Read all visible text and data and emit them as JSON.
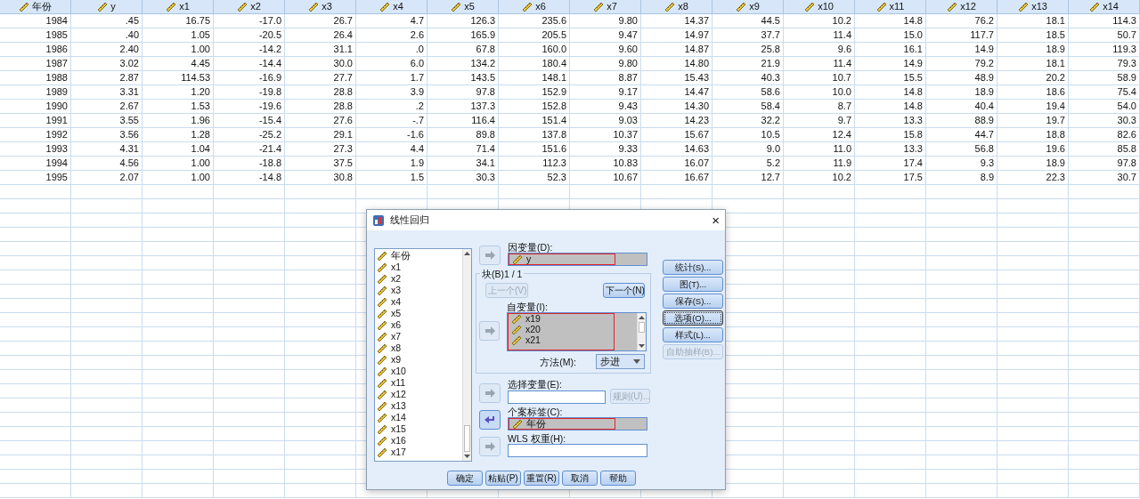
{
  "data_view": {
    "columns": [
      "年份",
      "y",
      "x1",
      "x2",
      "x3",
      "x4",
      "x5",
      "x6",
      "x7",
      "x8",
      "x9",
      "x10",
      "x11",
      "x12",
      "x13",
      "x14"
    ],
    "rows": [
      [
        "1984",
        ".45",
        "16.75",
        "-17.0",
        "26.7",
        "4.7",
        "126.3",
        "235.6",
        "9.80",
        "14.37",
        "44.5",
        "10.2",
        "14.8",
        "76.2",
        "18.1",
        "114.3"
      ],
      [
        "1985",
        ".40",
        "1.05",
        "-20.5",
        "26.4",
        "2.6",
        "165.9",
        "205.5",
        "9.47",
        "14.97",
        "37.7",
        "11.4",
        "15.0",
        "117.7",
        "18.5",
        "50.7"
      ],
      [
        "1986",
        "2.40",
        "1.00",
        "-14.2",
        "31.1",
        ".0",
        "67.8",
        "160.0",
        "9.60",
        "14.87",
        "25.8",
        "9.6",
        "16.1",
        "14.9",
        "18.9",
        "119.3"
      ],
      [
        "1987",
        "3.02",
        "4.45",
        "-14.4",
        "30.0",
        "6.0",
        "134.2",
        "180.4",
        "9.80",
        "14.80",
        "21.9",
        "11.4",
        "14.9",
        "79.2",
        "18.1",
        "79.3"
      ],
      [
        "1988",
        "2.87",
        "114.53",
        "-16.9",
        "27.7",
        "1.7",
        "143.5",
        "148.1",
        "8.87",
        "15.43",
        "40.3",
        "10.7",
        "15.5",
        "48.9",
        "20.2",
        "58.9"
      ],
      [
        "1989",
        "3.31",
        "1.20",
        "-19.8",
        "28.8",
        "3.9",
        "97.8",
        "152.9",
        "9.17",
        "14.47",
        "58.6",
        "10.0",
        "14.8",
        "18.9",
        "18.6",
        "75.4"
      ],
      [
        "1990",
        "2.67",
        "1.53",
        "-19.6",
        "28.8",
        ".2",
        "137.3",
        "152.8",
        "9.43",
        "14.30",
        "58.4",
        "8.7",
        "14.8",
        "40.4",
        "19.4",
        "54.0"
      ],
      [
        "1991",
        "3.55",
        "1.96",
        "-15.4",
        "27.6",
        "-.7",
        "116.4",
        "151.4",
        "9.03",
        "14.23",
        "32.2",
        "9.7",
        "13.3",
        "88.9",
        "19.7",
        "30.3"
      ],
      [
        "1992",
        "3.56",
        "1.28",
        "-25.2",
        "29.1",
        "-1.6",
        "89.8",
        "137.8",
        "10.37",
        "15.67",
        "10.5",
        "12.4",
        "15.8",
        "44.7",
        "18.8",
        "82.6"
      ],
      [
        "1993",
        "4.31",
        "1.04",
        "-21.4",
        "27.3",
        "4.4",
        "71.4",
        "151.6",
        "9.33",
        "14.63",
        "9.0",
        "11.0",
        "13.3",
        "56.8",
        "19.6",
        "85.8"
      ],
      [
        "1994",
        "4.56",
        "1.00",
        "-18.8",
        "37.5",
        "1.9",
        "34.1",
        "112.3",
        "10.83",
        "16.07",
        "5.2",
        "11.9",
        "17.4",
        "9.3",
        "18.9",
        "97.8"
      ],
      [
        "1995",
        "2.07",
        "1.00",
        "-14.8",
        "30.8",
        "1.5",
        "30.3",
        "52.3",
        "10.67",
        "16.67",
        "12.7",
        "10.2",
        "17.5",
        "8.9",
        "22.3",
        "30.7"
      ]
    ]
  },
  "dialog": {
    "title": "线性回归",
    "close": "×",
    "variables": [
      "年份",
      "x1",
      "x2",
      "x3",
      "x4",
      "x5",
      "x6",
      "x7",
      "x8",
      "x9",
      "x10",
      "x11",
      "x12",
      "x13",
      "x14",
      "x15",
      "x16",
      "x17"
    ],
    "dependent": {
      "label": "因变量(D):",
      "arrow": {
        "kind": "add",
        "disabled": true
      },
      "marked": true,
      "items": [
        "y"
      ]
    },
    "block": {
      "legend": "块(B)1 / 1",
      "previous": {
        "label": "上一个(V)",
        "disabled": true
      },
      "next": {
        "label": "下一个(N)",
        "disabled": false
      },
      "independent": {
        "label": "自变量(I):",
        "arrow": {
          "kind": "add",
          "disabled": true
        },
        "marked": true,
        "items": [
          "x19",
          "x20",
          "x21"
        ]
      },
      "method": {
        "label": "方法(M):",
        "value": "步进"
      }
    },
    "selection": {
      "label": "选择变量(E):",
      "arrow": {
        "kind": "add",
        "disabled": true
      },
      "rule_button": {
        "label": "规则(U)...",
        "disabled": true
      }
    },
    "case_labels": {
      "label": "个案标签(C):",
      "arrow": {
        "kind": "remove",
        "disabled": false
      },
      "marked": true,
      "items": [
        "年份"
      ]
    },
    "wls": {
      "label": "WLS 权重(H):",
      "arrow": {
        "kind": "add",
        "disabled": true
      }
    },
    "side_buttons": [
      {
        "label": "统计(S)...",
        "disabled": false,
        "focused": false
      },
      {
        "label": "图(T)...",
        "disabled": false,
        "focused": false
      },
      {
        "label": "保存(S)...",
        "disabled": false,
        "focused": false
      },
      {
        "label": "选项(O)...",
        "disabled": false,
        "focused": true
      },
      {
        "label": "样式(L)...",
        "disabled": false,
        "focused": false
      },
      {
        "label": "自助抽样(B)...",
        "disabled": true,
        "focused": false
      }
    ],
    "footer_buttons": [
      "确定",
      "粘贴(P)",
      "重置(R)",
      "取消",
      "帮助"
    ]
  }
}
